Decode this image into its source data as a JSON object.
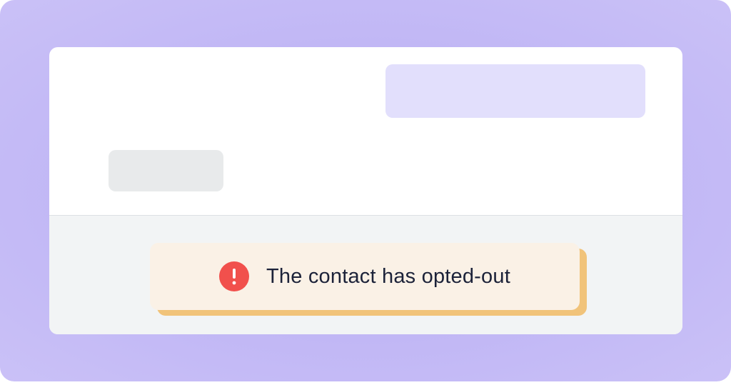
{
  "notice": {
    "message": "The contact has opted-out",
    "icon": "alert-circle-icon",
    "icon_color": "#f1504c",
    "background_color": "#faf1e6",
    "accent_color": "#f1c37a"
  },
  "theme": {
    "frame_color": "#c1b7f5",
    "outgoing_bubble_color": "#e2dffc",
    "incoming_bubble_color": "#e8eaeb",
    "footer_color": "#f2f4f5"
  }
}
